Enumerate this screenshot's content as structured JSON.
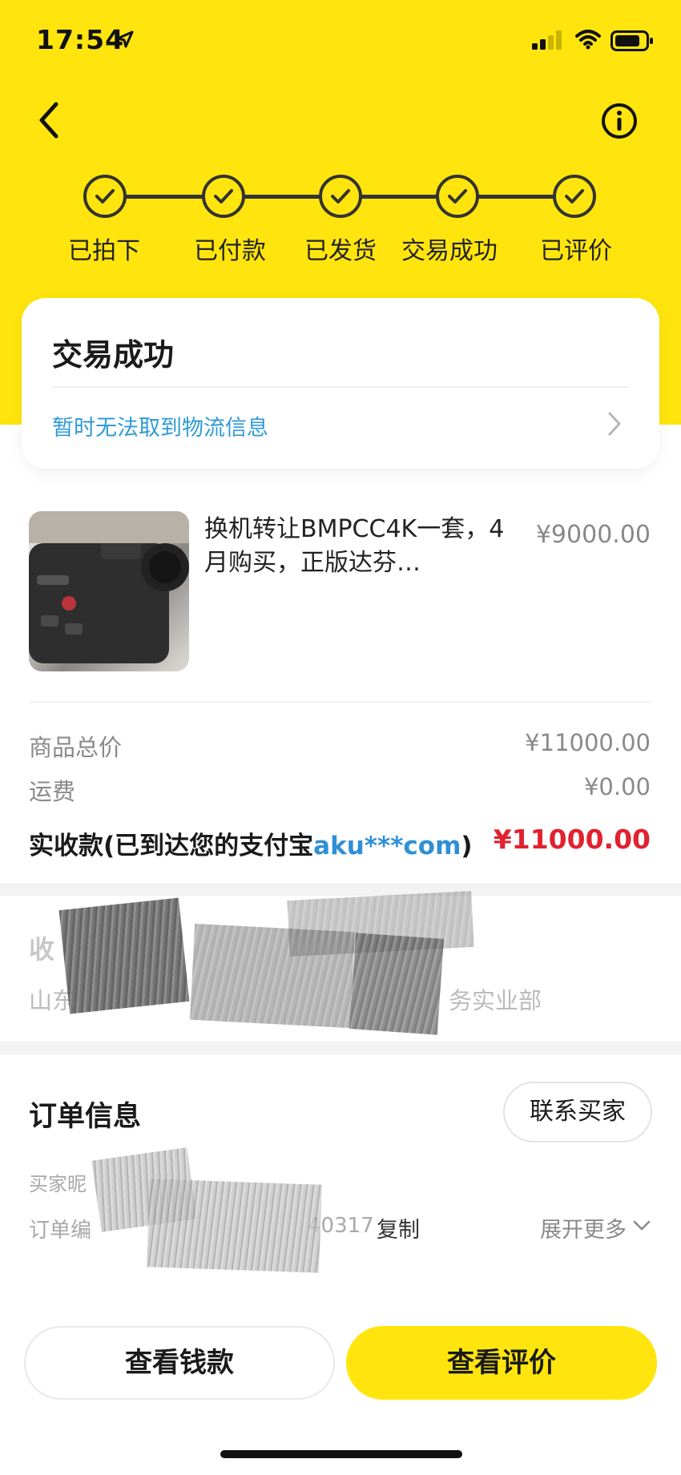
{
  "status_bar": {
    "time": "17:54"
  },
  "progress": {
    "steps": [
      {
        "label": "已拍下"
      },
      {
        "label": "已付款"
      },
      {
        "label": "已发货"
      },
      {
        "label": "交易成功"
      },
      {
        "label": "已评价"
      }
    ]
  },
  "status_card": {
    "title": "交易成功",
    "logistics": "暂时无法取到物流信息"
  },
  "product": {
    "title": "换机转让BMPCC4K一套，4月购买，正版达芬…",
    "price": "¥9000.00"
  },
  "summary": {
    "total_label": "商品总价",
    "total_value": "¥11000.00",
    "shipping_label": "运费",
    "shipping_value": "¥0.00",
    "received_prefix": "实收款(已到达您的支付宝",
    "received_account": "aku***com",
    "received_suffix": ")",
    "received_value": "¥11000.00"
  },
  "address": {
    "label_frag": "收",
    "line_start": "山东",
    "line_end": "务实业部"
  },
  "order_info": {
    "title": "订单信息",
    "contact_button": "联系买家",
    "buyer_label_frag": "买家昵",
    "order_no_label_frag": "订单编",
    "order_no_frag": "40317",
    "copy_label": "复制",
    "expand_label": "展开更多"
  },
  "actions": {
    "view_payment": "查看钱款",
    "view_review": "查看评价"
  },
  "colors": {
    "brand_yellow": "#ffe50d",
    "link_blue": "#2f9bd8",
    "price_red": "#e1222f"
  }
}
